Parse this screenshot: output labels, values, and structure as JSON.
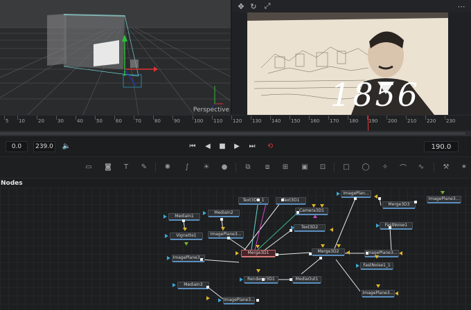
{
  "viewer_left": {
    "label": "Perspective"
  },
  "viewer_right": {
    "year_text": "1856"
  },
  "ruler": {
    "ticks": [
      "5",
      "10",
      "20",
      "30",
      "40",
      "50",
      "60",
      "70",
      "80",
      "90",
      "100",
      "110",
      "120",
      "130",
      "140",
      "150",
      "160",
      "170",
      "180",
      "190",
      "200",
      "210",
      "220",
      "230"
    ]
  },
  "transport": {
    "start": "0.0",
    "end": "239.0",
    "current": "190.0"
  },
  "nodes_panel": {
    "title": "Nodes"
  },
  "nodes": {
    "text3d1_1": "Text3D1_1",
    "text3d1": "Text3D1",
    "imageplane_top": "ImagePlan...",
    "merge3d3": "Merge3D3",
    "imageplane3_right": "ImagePlane3...",
    "media_in1": "MediaIn1",
    "media_in2": "MediaIn2",
    "camera3d1": "Camera3D1",
    "fastnoise1": "FastNoise1",
    "vignette1": "Vignette1",
    "imageplane3_a": "ImagePlane3...",
    "text3d2": "Text3D2",
    "merge3d1": "Merge3D1",
    "merge3d2": "Merge3D2",
    "imageplane3_b": "ImagePlane3...",
    "imageplane3_c": "ImagePlane3...",
    "fastnoise1_1": "FastNoise1_1",
    "renderer3d1": "Renderer3D1",
    "mediaout1": "MediaOut1",
    "media_in3": "MediaIn3",
    "imageplane3_d": "ImagePlane3...",
    "imageplane3_e": "ImagePlane3..."
  },
  "colors": {
    "accent_red": "#e0342f",
    "accent_yellow": "#e1b62a",
    "accent_blue": "#3aa8d8"
  }
}
